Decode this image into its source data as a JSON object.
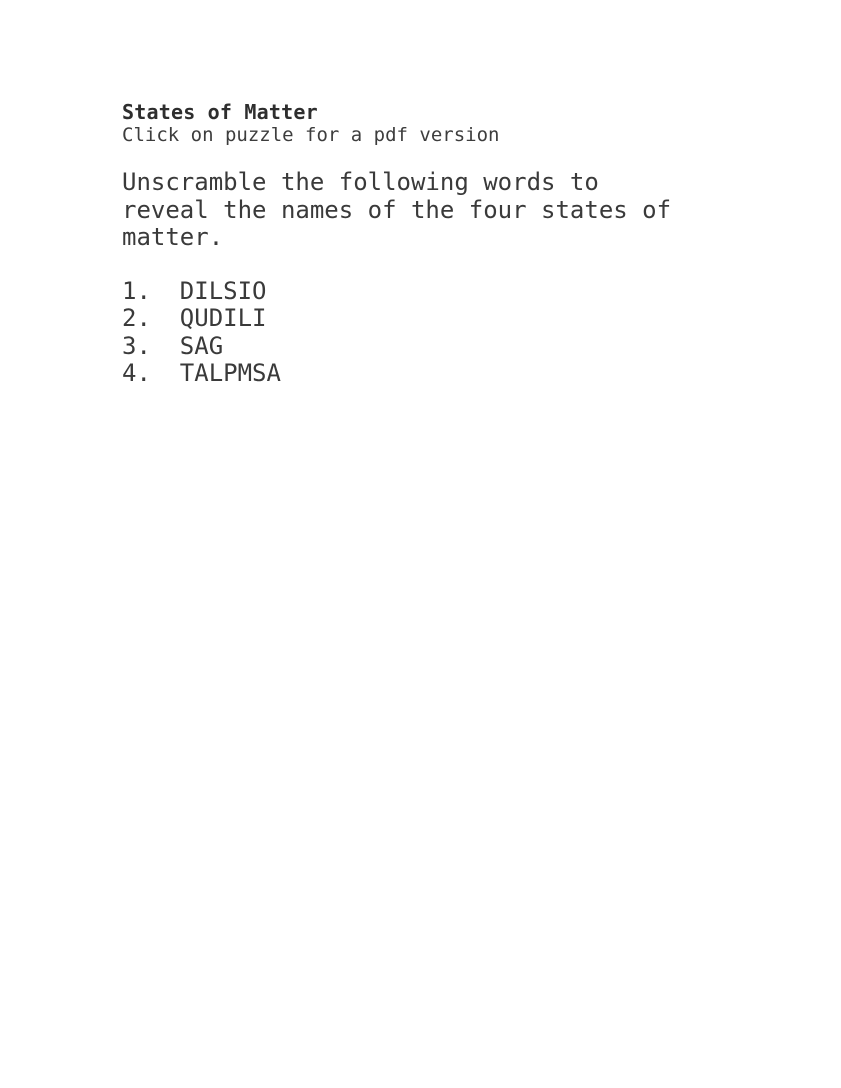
{
  "page": {
    "background_color": "#ffffff",
    "text_color": "#3a3a3a"
  },
  "worksheet": {
    "title": "States of Matter",
    "subtitle": "Click on puzzle for a pdf version",
    "instructions_lines": [
      "Unscramble the following words to",
      "reveal the names of the four states of",
      "matter."
    ],
    "items": [
      {
        "number": "1.",
        "word": "DILSIO"
      },
      {
        "number": "2.",
        "word": "QUDILI"
      },
      {
        "number": "3.",
        "word": "SAG"
      },
      {
        "number": "4.",
        "word": "TALPMSA"
      }
    ]
  }
}
